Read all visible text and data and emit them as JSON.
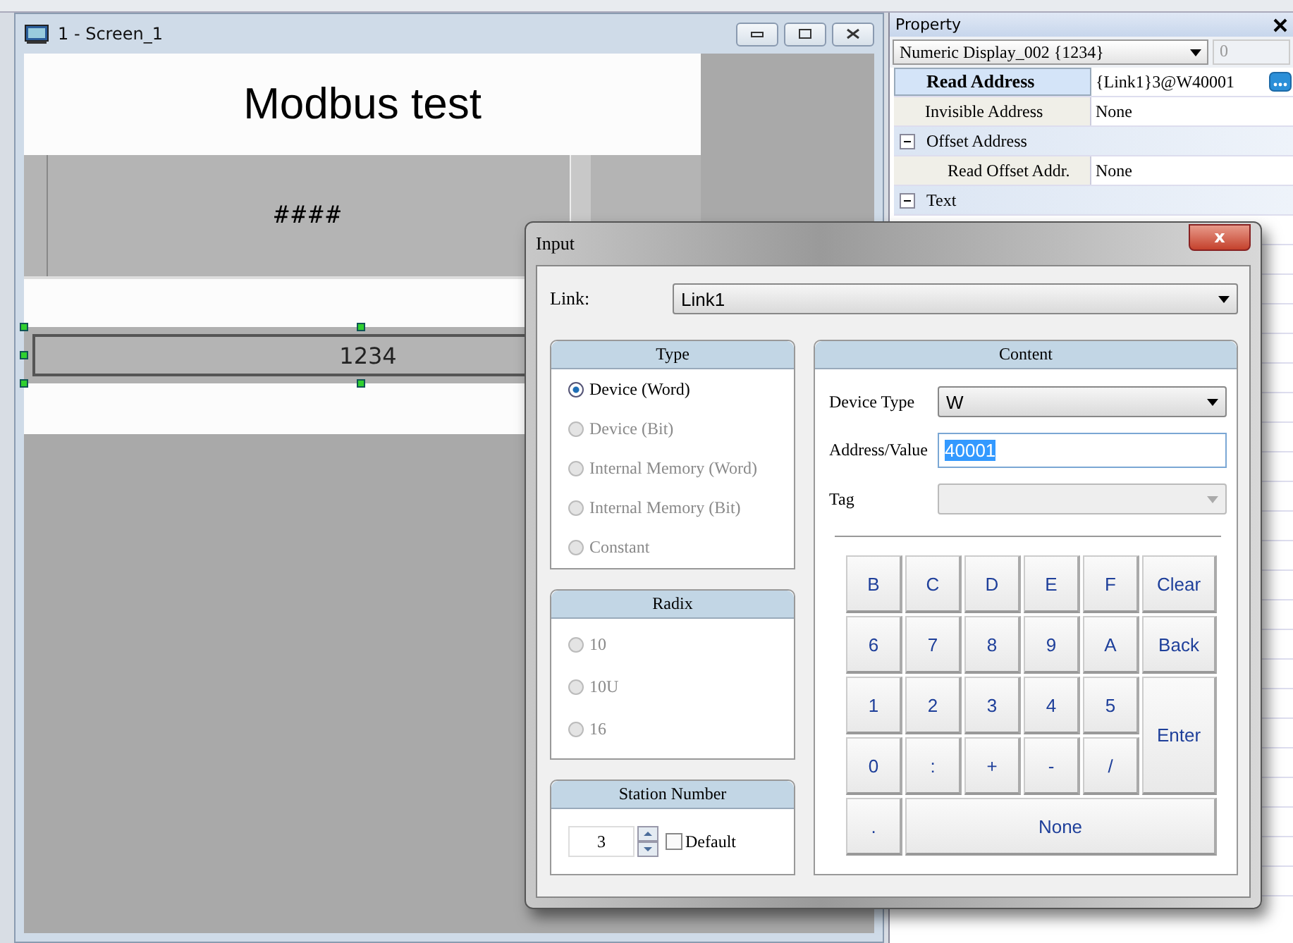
{
  "screen_window": {
    "title": "1 - Screen_1",
    "heading": "Modbus test",
    "display_text": "####",
    "numeric_value": "1234"
  },
  "property_panel": {
    "title": "Property",
    "object": "Numeric Display_002 {1234}",
    "spin_value": "0",
    "rows": [
      {
        "kind": "row",
        "name": "Read Address",
        "value": "{Link1}3@W40001",
        "selected": true,
        "has_button": true
      },
      {
        "kind": "row",
        "name": "Invisible Address",
        "value": "None",
        "selected": false,
        "has_button": false
      },
      {
        "kind": "category",
        "name": "Offset Address",
        "expanded": true
      },
      {
        "kind": "subrow",
        "name": "Read Offset Addr.",
        "value": "None",
        "selected": false,
        "has_button": false
      },
      {
        "kind": "category",
        "name": "Text",
        "expanded": true
      }
    ]
  },
  "dialog": {
    "title": "Input",
    "close": "x",
    "link_label": "Link:",
    "link_value": "Link1",
    "type_group": {
      "title": "Type",
      "options": [
        {
          "label": "Device (Word)",
          "selected": true,
          "disabled": false
        },
        {
          "label": "Device (Bit)",
          "selected": false,
          "disabled": true
        },
        {
          "label": "Internal Memory (Word)",
          "selected": false,
          "disabled": true
        },
        {
          "label": "Internal Memory (Bit)",
          "selected": false,
          "disabled": true
        },
        {
          "label": "Constant",
          "selected": false,
          "disabled": true
        }
      ]
    },
    "radix_group": {
      "title": "Radix",
      "options": [
        {
          "label": "10",
          "selected": false,
          "disabled": true
        },
        {
          "label": "10U",
          "selected": false,
          "disabled": true
        },
        {
          "label": "16",
          "selected": false,
          "disabled": true
        }
      ]
    },
    "station_group": {
      "title": "Station Number",
      "value": "3",
      "default_label": "Default",
      "default_checked": false
    },
    "content": {
      "title": "Content",
      "device_type_label": "Device Type",
      "device_type": "W",
      "address_label": "Address/Value",
      "address": "40001",
      "tag_label": "Tag",
      "keys": [
        {
          "label": "B",
          "kind": "key"
        },
        {
          "label": "C",
          "kind": "key"
        },
        {
          "label": "D",
          "kind": "key"
        },
        {
          "label": "E",
          "kind": "key"
        },
        {
          "label": "F",
          "kind": "key"
        },
        {
          "label": "Clear",
          "kind": "key"
        },
        {
          "label": "6",
          "kind": "key"
        },
        {
          "label": "7",
          "kind": "key"
        },
        {
          "label": "8",
          "kind": "key"
        },
        {
          "label": "9",
          "kind": "key"
        },
        {
          "label": "A",
          "kind": "key"
        },
        {
          "label": "Back",
          "kind": "key"
        },
        {
          "label": "1",
          "kind": "key"
        },
        {
          "label": "2",
          "kind": "key"
        },
        {
          "label": "3",
          "kind": "key"
        },
        {
          "label": "4",
          "kind": "key"
        },
        {
          "label": "5",
          "kind": "key"
        },
        {
          "label": "Enter",
          "kind": "tall"
        },
        {
          "label": "0",
          "kind": "key"
        },
        {
          "label": ":",
          "kind": "key"
        },
        {
          "label": "+",
          "kind": "key"
        },
        {
          "label": "-",
          "kind": "key"
        },
        {
          "label": "/",
          "kind": "key"
        },
        {
          "label": ".",
          "kind": "key"
        },
        {
          "label": "None",
          "kind": "wide"
        }
      ]
    }
  }
}
